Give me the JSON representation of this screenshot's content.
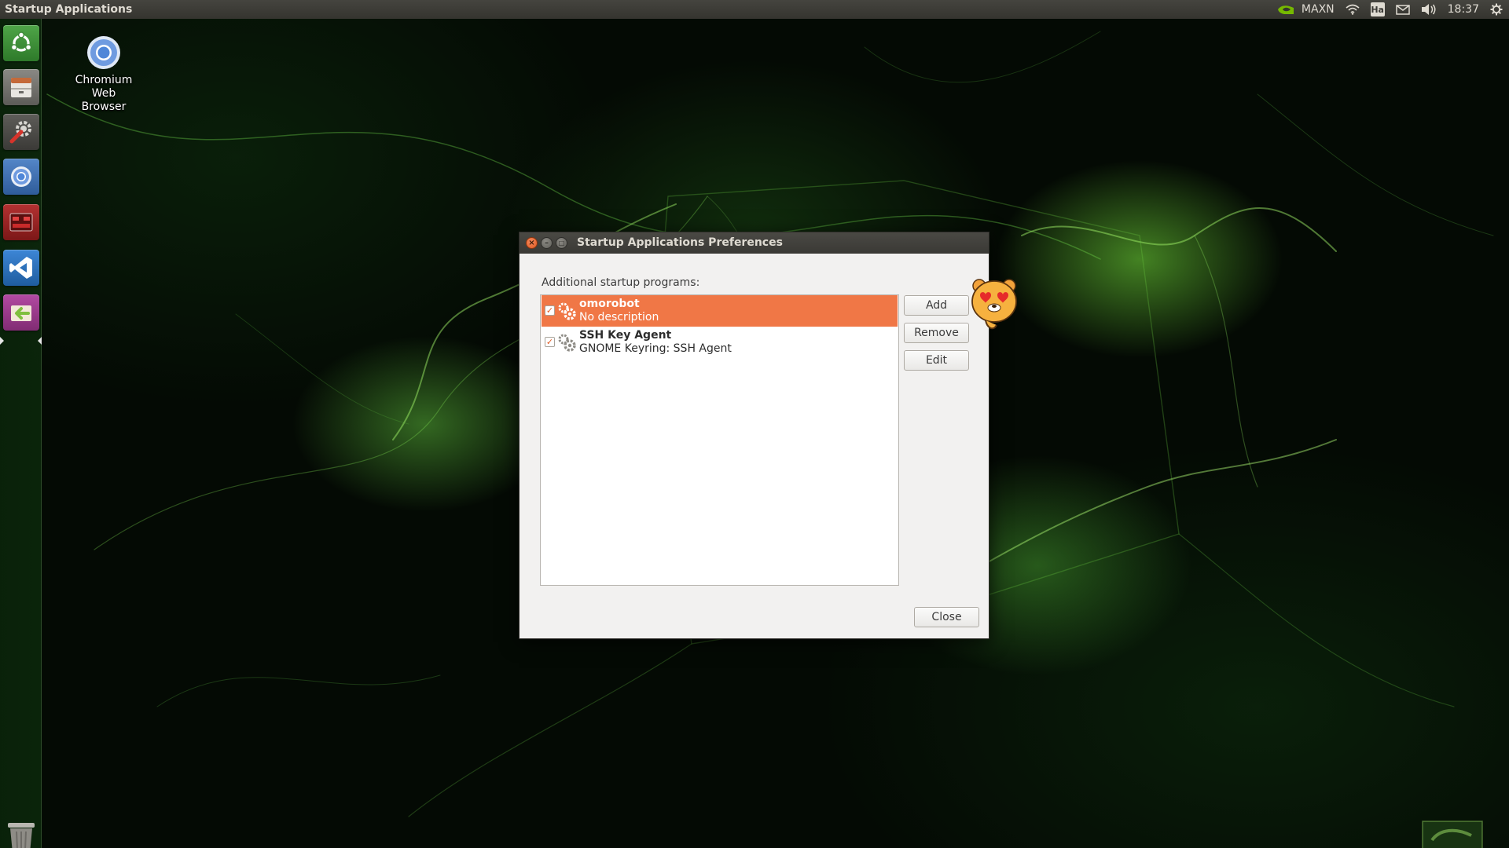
{
  "top_panel": {
    "window_title": "Startup Applications",
    "power_mode": "MAXN",
    "keyboard_layout": "Ha",
    "clock": "18:37"
  },
  "launcher": {
    "items": [
      {
        "name": "ubuntu-dash",
        "icon": "ubuntu-logo-icon",
        "color": "#3f8a3a"
      },
      {
        "name": "files",
        "icon": "file-cabinet-icon",
        "color": "#6b6a66"
      },
      {
        "name": "system-settings",
        "icon": "wrench-gear-icon",
        "color": "#4d4d4a"
      },
      {
        "name": "chromium",
        "icon": "chromium-icon",
        "color": "#3a5f9a"
      },
      {
        "name": "terminal-app",
        "icon": "red-terminal-icon",
        "color": "#8b1e1e"
      },
      {
        "name": "vscode",
        "icon": "vscode-icon",
        "color": "#2a6db0"
      },
      {
        "name": "startup-applications",
        "icon": "startup-arrow-icon",
        "color": "#9b3a8c"
      }
    ],
    "trash_icon": "trash-icon"
  },
  "desktop": {
    "chromium_label": "Chromium Web Browser"
  },
  "dialog": {
    "title": "Startup Applications Preferences",
    "section_label": "Additional startup programs:",
    "programs": [
      {
        "name": "omorobot",
        "description": "No description",
        "enabled": true,
        "selected": true
      },
      {
        "name": "SSH Key Agent",
        "description": "GNOME Keyring: SSH Agent",
        "enabled": true,
        "selected": false
      }
    ],
    "buttons": {
      "add": "Add",
      "remove": "Remove",
      "edit": "Edit",
      "close": "Close"
    }
  },
  "colors": {
    "selection": "#f07746",
    "accent_close": "#e05a23",
    "panel": "#3b3a36",
    "wallpaper_glow": "#78e63c"
  }
}
